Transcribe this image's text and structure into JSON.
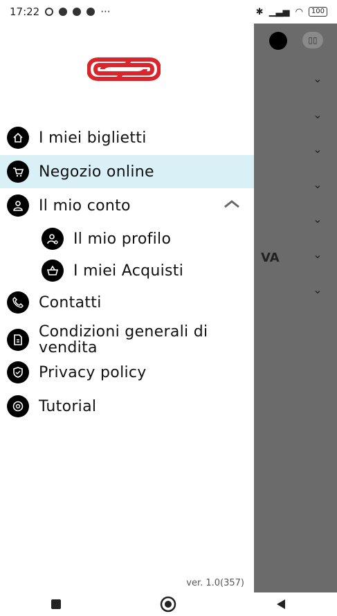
{
  "status": {
    "time": "17:22",
    "dots": "···",
    "battery": "100"
  },
  "drawer": {
    "items": [
      {
        "label": "I miei biglietti",
        "icon": "home-icon"
      },
      {
        "label": "Negozio online",
        "icon": "cart-icon",
        "active": true
      },
      {
        "label": "Il mio conto",
        "icon": "user-icon",
        "expanded": true
      },
      {
        "label": "Il mio profilo",
        "icon": "user-settings-icon",
        "sub": true
      },
      {
        "label": "I miei Acquisti",
        "icon": "basket-icon",
        "sub": true
      },
      {
        "label": "Contatti",
        "icon": "phone-icon"
      },
      {
        "label": "Condizioni generali di vendita",
        "icon": "document-icon"
      },
      {
        "label": "Privacy policy",
        "icon": "shield-icon"
      },
      {
        "label": "Tutorial",
        "icon": "help-icon"
      }
    ],
    "version": "ver. 1.0(357)"
  },
  "background": {
    "partial_text": "VA",
    "chevron": "⌄"
  },
  "colors": {
    "brand": "#d9262c",
    "active_bg": "#d9f0f7",
    "overlay": "#6b6b6b"
  }
}
